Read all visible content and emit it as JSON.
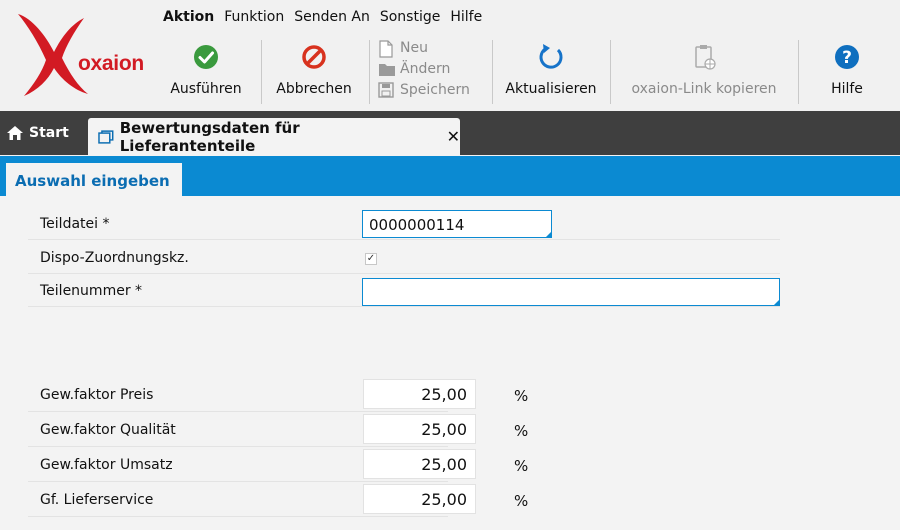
{
  "brand": {
    "logo_text": "oxaion",
    "logo_color": "#d21a23"
  },
  "menu": [
    {
      "label": "Aktion",
      "bold": true
    },
    {
      "label": "Funktion"
    },
    {
      "label": "Senden An"
    },
    {
      "label": "Sonstige"
    },
    {
      "label": "Hilfe"
    }
  ],
  "toolbar": {
    "execute_label": "Ausführen",
    "cancel_label": "Abbrechen",
    "new_label": "Neu",
    "edit_label": "Ändern",
    "save_label": "Speichern",
    "refresh_label": "Aktualisieren",
    "copy_link_label": "oxaion-Link kopieren",
    "help_label": "Hilfe"
  },
  "tabs": {
    "start_label": "Start",
    "active_label": "Bewertungsdaten für Lieferantenteile",
    "close_glyph": "✕"
  },
  "section": {
    "tab_label": "Auswahl eingeben",
    "accent": "#0b8ad2"
  },
  "fields": {
    "teildatei_label": "Teildatei *",
    "teildatei_value": "0000000114",
    "dispo_label": "Dispo-Zuordnungskz.",
    "dispo_checked": "✓",
    "teilenummer_label": "Teilenummer *",
    "teilenummer_value": ""
  },
  "weights": [
    {
      "label": "Gew.faktor Preis",
      "value": "25,00",
      "unit": "%"
    },
    {
      "label": "Gew.faktor Qualität",
      "value": "25,00",
      "unit": "%"
    },
    {
      "label": "Gew.faktor Umsatz",
      "value": "25,00",
      "unit": "%"
    },
    {
      "label": "Gf. Lieferservice",
      "value": "25,00",
      "unit": "%"
    }
  ]
}
